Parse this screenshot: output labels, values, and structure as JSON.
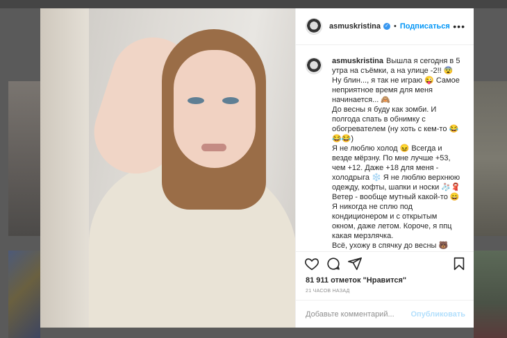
{
  "post": {
    "username": "asmuskristina",
    "follow_label": "Подписаться",
    "more_label": "•••",
    "caption_lines": [
      "Вышла я сегодня в 5",
      "утра на съёмки, а на улице -2!! 😨",
      "Ну блин..., я так не играю 😜 Самое",
      "неприятное время для меня",
      "начинается... 🙈",
      "До весны я буду как зомби. И",
      "полгода спать в обнимку с",
      "обогревателем (ну хоть с кем-то 😂",
      "😂😂)",
      "Я не люблю холод 😖 Всегда и",
      "везде мёрзну. По мне лучше +53,",
      "чем +12. Даже +18 для меня -",
      "холодрыга ❄️ Я не люблю верхнюю",
      "одежду, кофты, шапки и носки 🧦🧣",
      "Ветер - вообще мутный какой-то 😄",
      "Я никогда не сплю под",
      "кондиционером и с открытым",
      "окном, даже летом. Короче, я ппц",
      "какая мерзлячка.",
      "Всё, ухожу в спячку до весны 🐻"
    ],
    "likes_text": "81 911 отметок \"Нравится\"",
    "time_text": "21 ЧАСОВ НАЗАД",
    "comment_placeholder": "Добавьте комментарий...",
    "publish_label": "Опубликовать"
  },
  "colors": {
    "link_blue": "#0095f6",
    "publish_disabled": "#b2dffc",
    "verified": "#3897f0"
  },
  "icons": [
    "heart-icon",
    "comment-icon",
    "share-icon",
    "bookmark-icon",
    "verified-badge-icon",
    "more-options-icon"
  ]
}
